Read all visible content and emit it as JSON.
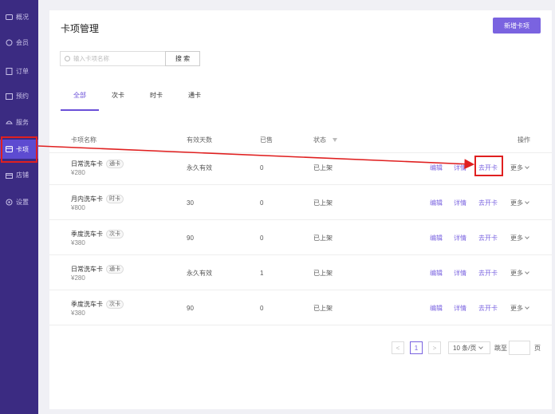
{
  "sidebar": {
    "items": [
      {
        "label": "概况",
        "icon": "overview-icon"
      },
      {
        "label": "会员",
        "icon": "member-icon"
      },
      {
        "label": "订单",
        "icon": "order-icon"
      },
      {
        "label": "预约",
        "icon": "reservation-icon"
      },
      {
        "label": "服务",
        "icon": "service-icon"
      },
      {
        "label": "卡项",
        "icon": "card-icon",
        "active": true
      },
      {
        "label": "店铺",
        "icon": "shop-icon"
      },
      {
        "label": "设置",
        "icon": "settings-icon"
      }
    ]
  },
  "header": {
    "title": "卡项管理",
    "add_label": "新增卡项"
  },
  "search": {
    "placeholder": "输入卡项名称",
    "button_label": "搜 索"
  },
  "tabs": [
    {
      "label": "全部",
      "active": true
    },
    {
      "label": "次卡"
    },
    {
      "label": "时卡"
    },
    {
      "label": "通卡"
    }
  ],
  "table": {
    "columns": [
      "卡项名称",
      "有效天数",
      "已售",
      "状态",
      "操作"
    ],
    "rows": [
      {
        "name": "日常洗车卡",
        "tag": "通卡",
        "price": "¥280",
        "days": "永久有效",
        "sold": "0",
        "status": "已上架"
      },
      {
        "name": "月内洗车卡",
        "tag": "时卡",
        "price": "¥800",
        "days": "30",
        "sold": "0",
        "status": "已上架"
      },
      {
        "name": "季度洗车卡",
        "tag": "次卡",
        "price": "¥380",
        "days": "90",
        "sold": "0",
        "status": "已上架"
      },
      {
        "name": "日常洗车卡",
        "tag": "通卡",
        "price": "¥280",
        "days": "永久有效",
        "sold": "1",
        "status": "已上架"
      },
      {
        "name": "季度洗车卡",
        "tag": "次卡",
        "price": "¥380",
        "days": "90",
        "sold": "0",
        "status": "已上架"
      }
    ],
    "ops": {
      "edit": "编辑",
      "detail": "详情",
      "issue": "去开卡",
      "more": "更多"
    }
  },
  "pagination": {
    "prev": "<",
    "current": "1",
    "next": ">",
    "page_size": "10 条/页",
    "goto": "跳至",
    "page_unit": "页"
  },
  "colors": {
    "sidebar": "#3b2b82",
    "accent": "#7a63e0",
    "highlight": "#e02020"
  }
}
